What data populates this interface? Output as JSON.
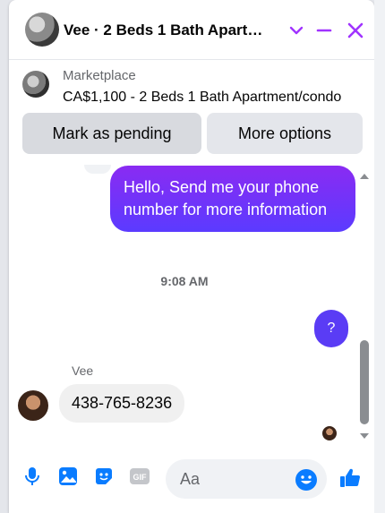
{
  "header": {
    "title": "Vee · 2 Beds 1 Bath Apart…",
    "icons": [
      "chevron-down-icon",
      "minimize-icon",
      "close-icon"
    ],
    "accent": "#a033ff"
  },
  "marketplace": {
    "label": "Marketplace",
    "listing": "CA$1,100 - 2 Beds 1 Bath Apartment/condo"
  },
  "actions": {
    "mark_pending": "Mark as pending",
    "more_options": "More options",
    "peek": "tl"
  },
  "messages": {
    "outgoing_1": "Hello, Send me your phone number for more information",
    "timestamp": "9:08 AM",
    "outgoing_2": "?",
    "sender_name": "Vee",
    "incoming_1": "438-765-8236"
  },
  "composer": {
    "placeholder": "Aa",
    "icons": [
      "microphone-icon",
      "image-icon",
      "sticker-icon",
      "gif-icon",
      "emoji-icon",
      "thumbs-up-icon"
    ],
    "gif_label": "GIF"
  },
  "colors": {
    "bubble_gradient_top": "#8a2bf2",
    "bubble_gradient_bottom": "#5b3bff",
    "icon_blue": "#0a7cff"
  }
}
